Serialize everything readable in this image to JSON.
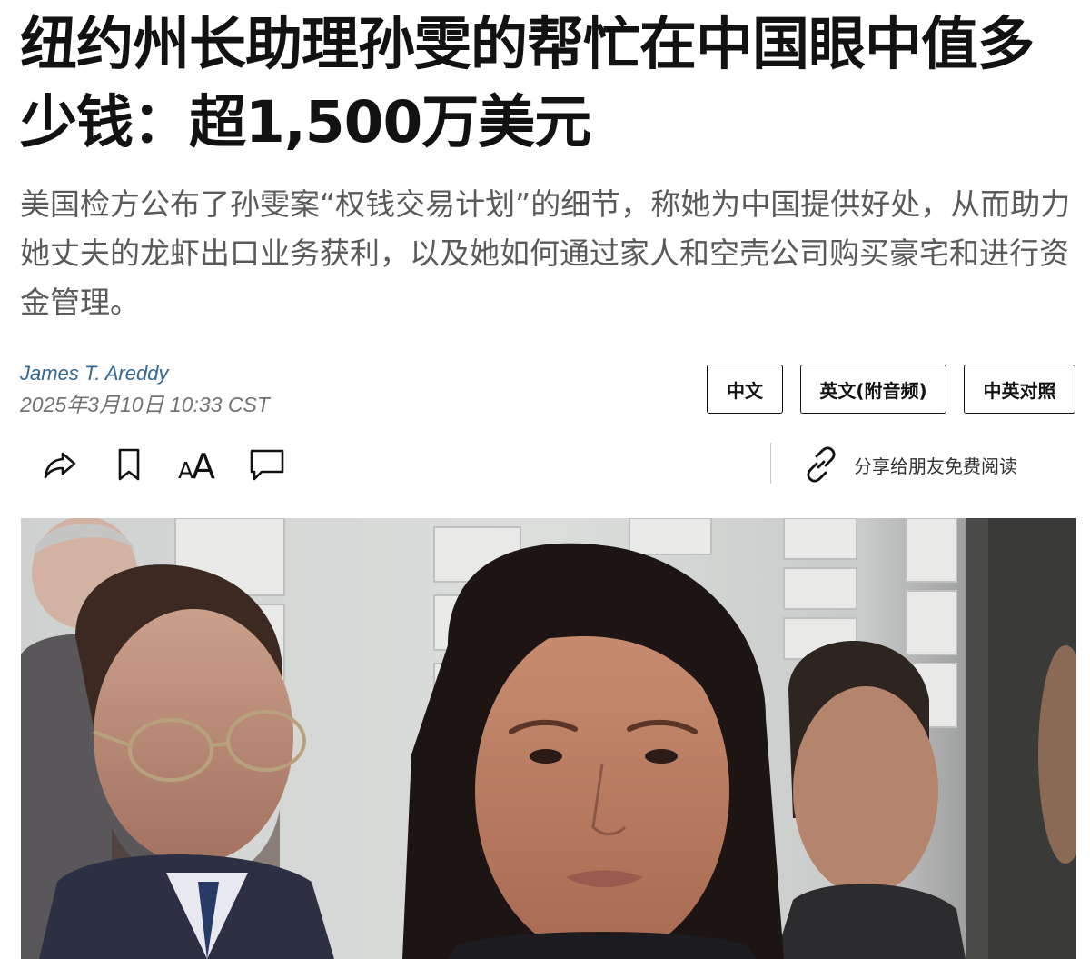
{
  "article": {
    "headline": "纽约州长助理孙雯的帮忙在中国眼中值多少钱：超1,500万美元",
    "summary": "美国检方公布了孙雯案“权钱交易计划”的细节，称她为中国提供好处，从而助力她丈夫的龙虾出口业务获利，以及她如何通过家人和空壳公司购买豪宅和进行资金管理。",
    "author": "James T. Areddy",
    "date": "2025年3月10日 10:33 CST"
  },
  "language_switch": {
    "chinese": "中文",
    "english_audio": "英文(附音频)",
    "bilingual": "中英对照"
  },
  "toolbar": {
    "share_icon": "share-arrow-icon",
    "bookmark_icon": "bookmark-icon",
    "font_size_icon": "font-size-icon",
    "font_size_glyph": "AA",
    "comment_icon": "comment-icon",
    "gift_icon": "link-icon",
    "gift_label": "分享给朋友免费阅读"
  },
  "colors": {
    "author_link": "#326891",
    "summary_text": "#5a5a5a",
    "date_text": "#727272"
  }
}
